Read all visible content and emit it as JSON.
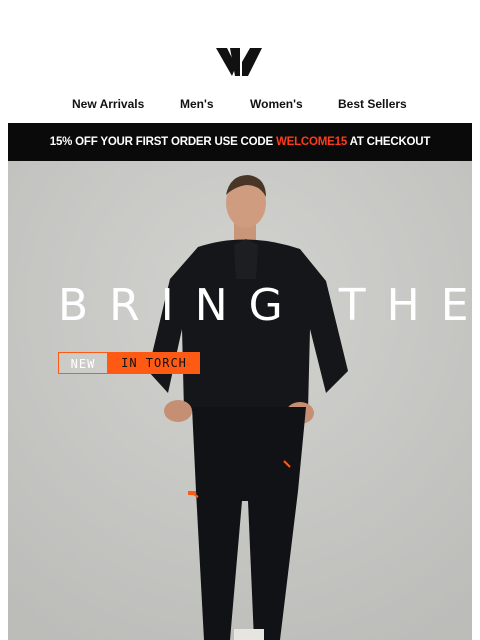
{
  "brand": {
    "logo_icon": "brand-logo-icon"
  },
  "nav": {
    "items": [
      {
        "label": "New Arrivals"
      },
      {
        "label": "Men's"
      },
      {
        "label": "Women's"
      },
      {
        "label": "Best Sellers"
      }
    ]
  },
  "promo": {
    "prefix": "15% OFF YOUR FIRST ORDER USE CODE ",
    "code": "WELCOME15",
    "suffix": " AT CHECKOUT",
    "code_color": "#ff3a1d",
    "background": "#0a0a0a"
  },
  "hero": {
    "headline": "BRING THE FIRE",
    "tag_new": "NEW",
    "tag_color": "IN TORCH",
    "accent_color": "#ff5a14"
  }
}
